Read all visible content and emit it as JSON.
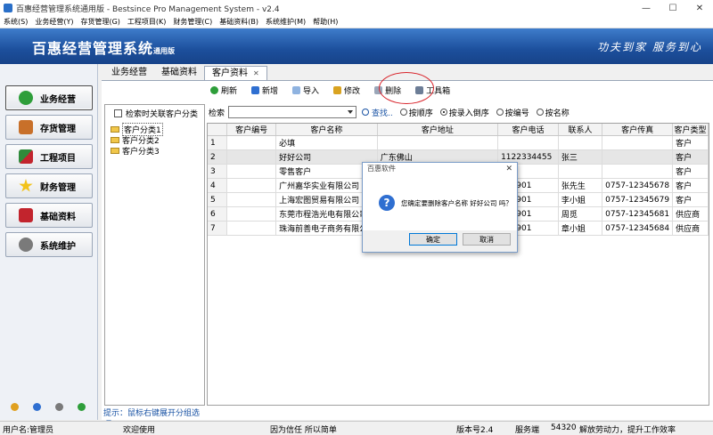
{
  "window": {
    "title": "百惠经营管理系统通用版 - Bestsince Pro Management System - v2.4",
    "minimize": "—",
    "maximize": "☐",
    "close": "✕"
  },
  "menu": [
    "系统(S)",
    "业务经营(Y)",
    "存货管理(G)",
    "工程项目(K)",
    "财务管理(C)",
    "基础资料(B)",
    "系统维护(M)",
    "帮助(H)"
  ],
  "banner": {
    "brand": "百惠经营管理系统",
    "edition": "通用版",
    "slogan": "功夫到家  服务到心"
  },
  "sidebar": {
    "items": [
      {
        "label": "业务经营",
        "icon": "check-circle-icon",
        "color": "#2e9e3a"
      },
      {
        "label": "存货管理",
        "icon": "house-icon",
        "color": "#c8702a"
      },
      {
        "label": "工程项目",
        "icon": "puzzle-icon",
        "color": "#2f8a3a"
      },
      {
        "label": "财务管理",
        "icon": "star-icon",
        "color": "#f2c21a"
      },
      {
        "label": "基础资料",
        "icon": "book-icon",
        "color": "#c2242d"
      },
      {
        "label": "系统维护",
        "icon": "gear-icon",
        "color": "#7a7a7a"
      }
    ],
    "footer_icons": [
      "edit-icon",
      "info-icon",
      "help-icon",
      "exit-icon"
    ]
  },
  "tabs": [
    {
      "label": "业务经营"
    },
    {
      "label": "基础资料"
    },
    {
      "label": "客户资料",
      "active": true,
      "close": "✕"
    }
  ],
  "toolbar": {
    "refresh": "刷新",
    "add": "新增",
    "import": "导入",
    "edit": "修改",
    "delete": "删除",
    "toolbox": "工具箱"
  },
  "tree": {
    "checkbox_label": "检索时关联客户分类",
    "nodes": [
      "客户分类1",
      "客户分类2",
      "客户分类3"
    ],
    "hint": "提示：鼠标右键展开分组选项"
  },
  "search": {
    "label": "检索",
    "value": "",
    "find": "查找..",
    "options": [
      {
        "label": "按顺序",
        "checked": false
      },
      {
        "label": "按录入倒序",
        "checked": true
      },
      {
        "label": "按编号",
        "checked": false
      },
      {
        "label": "按名称",
        "checked": false
      }
    ]
  },
  "grid": {
    "columns": [
      "",
      "客户编号",
      "客户名称",
      "客户地址",
      "客户电话",
      "联系人",
      "客户传真",
      "客户类型"
    ],
    "rows": [
      [
        "1",
        "",
        "必填",
        "",
        "",
        "",
        "",
        "客户"
      ],
      [
        "2",
        "",
        "好好公司",
        "广东佛山",
        "11223344​55",
        "张三",
        "",
        "客户"
      ],
      [
        "3",
        "",
        "零售客户",
        "",
        "",
        "",
        "",
        "客户"
      ],
      [
        "4",
        "",
        "广州嘉华实业有限公司",
        "",
        "578901",
        "张先生",
        "0757-12345678",
        "客户"
      ],
      [
        "5",
        "",
        "上海宏图贸易有限公司",
        "",
        "578901",
        "李小姐",
        "0757-12345679",
        "客户"
      ],
      [
        "6",
        "",
        "东莞市程浩光电有限公司",
        "",
        "578901",
        "周觅",
        "0757-12345681",
        "供应商"
      ],
      [
        "7",
        "",
        "珠海前善电子商务有限公",
        "",
        "578901",
        "章小姐",
        "0757-12345684",
        "供应商"
      ]
    ],
    "selected_row": 1
  },
  "dialog": {
    "title": "百惠软件",
    "close": "✕",
    "message": "您确定要删除客户名称 好好公司 吗？",
    "ok": "确定",
    "cancel": "取消"
  },
  "status": {
    "user": "用户名:管理员",
    "welcome": "欢迎使用",
    "motto": "因为信任 所以简单",
    "version": "版本号2.4",
    "edition": "服务端",
    "port": "54320",
    "slogan": "解放劳动力，提升工作效率"
  }
}
